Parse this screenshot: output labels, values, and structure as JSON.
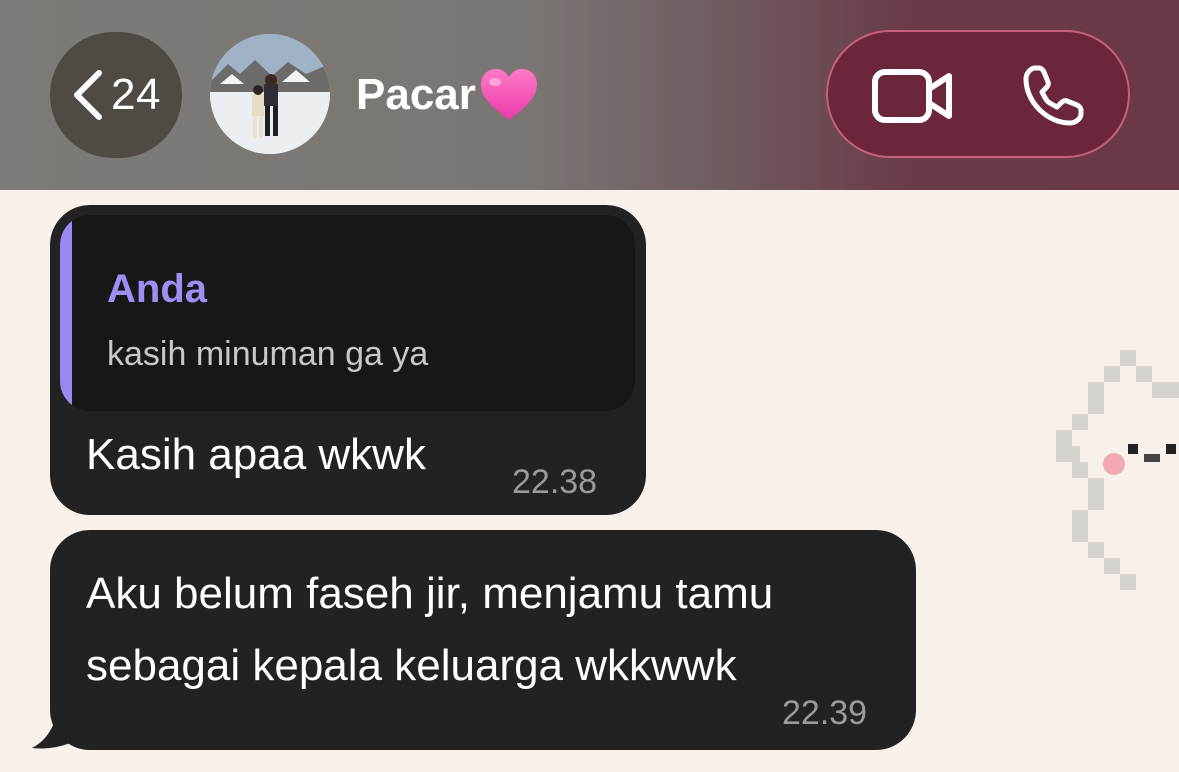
{
  "header": {
    "back_count": "24",
    "contact_name": "Pacar",
    "contact_emoji": "💗"
  },
  "messages": [
    {
      "reply_to": {
        "author": "Anda",
        "text": "kasih minuman ga ya"
      },
      "text": "Kasih apaa wkwk",
      "time": "22.38"
    },
    {
      "text": "Aku belum faseh jir, menjamu tamu sebagai kepala keluarga wkkwwk",
      "time": "22.39"
    }
  ],
  "colors": {
    "bubble": "#222222",
    "quote_accent": "#9b88f0",
    "call_pill": "#6b2739",
    "chat_background": "#f8f0ea"
  },
  "icons": [
    "chevron-left-icon",
    "video-camera-icon",
    "phone-icon",
    "pink-heart-icon"
  ]
}
